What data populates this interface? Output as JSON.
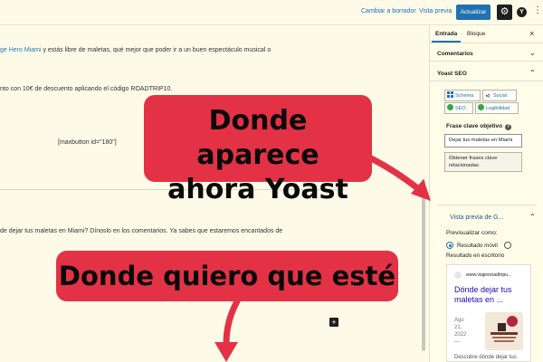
{
  "toolbar": {
    "draft_label": "Cambiar a borrador",
    "preview_label": "Vista previa",
    "update_label": "Actualizar",
    "settings_icon": "gear-icon",
    "yoast_icon": "yoast-icon",
    "more_icon": "more-vertical-icon"
  },
  "editor": {
    "p1_link": "ge Hero Miami",
    "p1_text": " y estás libre de maletas, qué mejor que poder ir a un buen espectáculo musical o",
    "p2_text": "nto con 10€ de descuento aplicando el código ROADTRIP10.",
    "p3_text": "[maxbutton id=\"180\"]",
    "p4_text": "de dejar tus maletas en Miami? Dínoslo en los comentarios. Ya sabes que estaremos encantados de",
    "plus_label": "+"
  },
  "sidebar": {
    "tab_entrada": "Entrada",
    "tab_bloque": "Bloque",
    "close_label": "×",
    "comentarios_label": "Comentarios",
    "yoast_label": "Yoast SEO",
    "yoast_tabs": [
      "Schema",
      "Social",
      "SEO",
      "Legibilidad"
    ],
    "keyphrase_label": "Frase clave objetivo",
    "keyphrase_help": "?",
    "keyphrase_value": "Dejar tus maletas en Miami",
    "related_button": "Obtener frases clave relacionadas",
    "preview_title": "Vista previa de G...",
    "preview_as_label": "Previsualizar como:",
    "mobile_label": "Resultado móvil",
    "desktop_label": "Resultado en escritorio",
    "serp": {
      "url": "www.viajesroadtripu...",
      "title": "Dónde dejar tus maletas en ...",
      "date": "Ago 21, 2022 —",
      "description": "Descubre dónde dejar tus maletas en Miami para disfrutar al máximo de la"
    }
  },
  "callouts": {
    "top_line1": "Donde aparece",
    "top_line2": "ahora Yoast",
    "bottom": "Donde quiero que esté"
  },
  "colors": {
    "accent": "#2271b1",
    "callout": "#e33246",
    "background": "#fdfbe8"
  }
}
